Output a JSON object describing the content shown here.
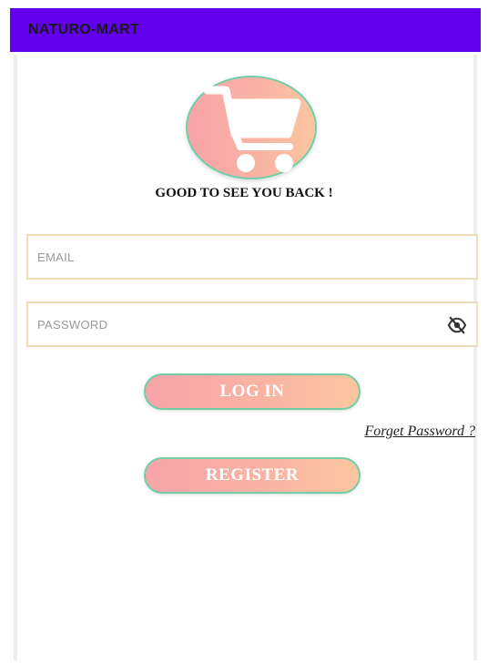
{
  "app": {
    "title": "NATURO-MART"
  },
  "icons": {
    "logo": "shopping-cart-icon",
    "password_toggle": "eye-off-icon"
  },
  "colors": {
    "appbar": "#6200ee",
    "button_gradient_start": "#f8a3a8",
    "button_gradient_end": "#fbc6a0",
    "button_border": "#6fcfa6",
    "field_border": "#f2dcbc"
  },
  "login": {
    "greeting": "GOOD TO SEE YOU BACK !",
    "email_placeholder": "EMAIL",
    "email_value": "",
    "password_placeholder": "PASSWORD",
    "password_value": "",
    "login_label": "LOG IN",
    "forget_label": "Forget Password ?",
    "register_label": "REGISTER"
  }
}
